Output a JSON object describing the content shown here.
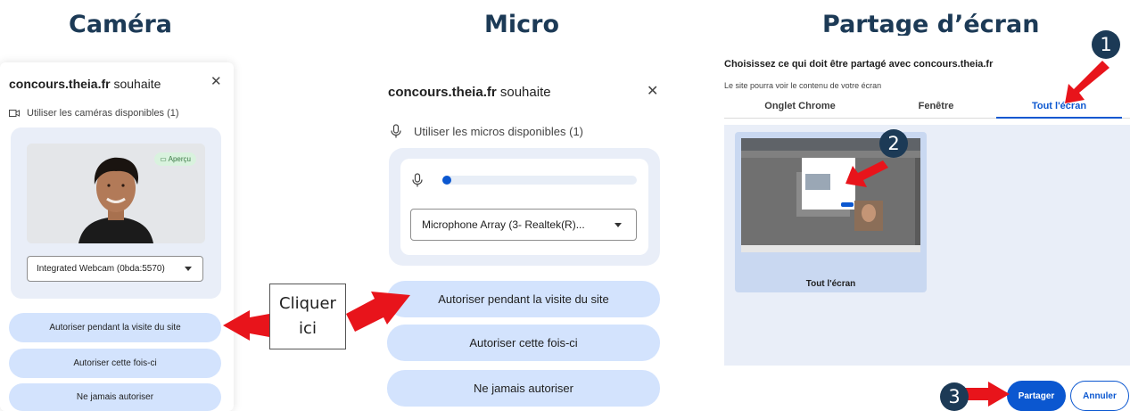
{
  "titles": {
    "camera": "Caméra",
    "micro": "Micro",
    "share": "Partage d’écran"
  },
  "camera_dialog": {
    "site": "concours.theia.fr",
    "title_suffix": " souhaite",
    "permission": "Utiliser les caméras disponibles (1)",
    "preview_badge": "Aperçu",
    "device_select": "Integrated Webcam (0bda:5570)",
    "buttons": {
      "allow_visit": "Autoriser pendant la visite du site",
      "allow_once": "Autoriser cette fois-ci",
      "never": "Ne jamais autoriser"
    }
  },
  "micro_dialog": {
    "site": "concours.theia.fr",
    "title_suffix": " souhaite",
    "permission": "Utiliser les micros disponibles (1)",
    "device_select": "Microphone Array (3- Realtek(R)...",
    "buttons": {
      "allow_visit": "Autoriser pendant la visite du site",
      "allow_once": "Autoriser cette fois-ci",
      "never": "Ne jamais autoriser"
    }
  },
  "share_dialog": {
    "heading": "Choisissez ce qui doit être partagé avec concours.theia.fr",
    "subheading": "Le site pourra voir le contenu de votre écran",
    "tabs": [
      "Onglet Chrome",
      "Fenêtre",
      "Tout l'écran"
    ],
    "active_tab": "Tout l'écran",
    "thumbnail_label": "Tout l'écran",
    "share_button": "Partager",
    "cancel_button": "Annuler"
  },
  "annotations": {
    "callout_line1": "Cliquer",
    "callout_line2": "ici",
    "step1": "1",
    "step2": "2",
    "step3": "3",
    "arrow_color": "#e8141b",
    "badge_color": "#1c3a56"
  },
  "colors": {
    "accent": "#0b57d0",
    "pill": "#d3e3fd",
    "panel_bg": "#e9eef8"
  }
}
